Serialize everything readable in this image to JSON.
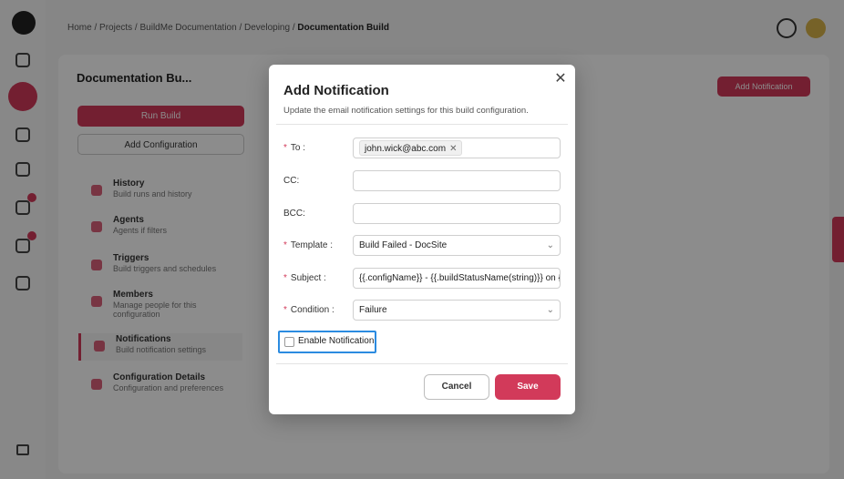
{
  "background": {
    "breadcrumb": {
      "items": [
        "Home",
        "Projects",
        "BuildMe Documentation",
        "Developing"
      ],
      "current": "Documentation Build"
    },
    "panel_title": "Documentation Bu...",
    "run_build": "Run Build",
    "add_config": "Add Configuration",
    "menu": [
      {
        "title": "History",
        "sub": "Build runs and history"
      },
      {
        "title": "Agents",
        "sub": "Agents if filters"
      },
      {
        "title": "Triggers",
        "sub": "Build triggers and schedules"
      },
      {
        "title": "Members",
        "sub": "Manage people for this configuration"
      },
      {
        "title": "Notifications",
        "sub": "Build notification settings"
      },
      {
        "title": "Configuration Details",
        "sub": "Configuration and preferences"
      }
    ],
    "add_notification_btn": "Add Notification",
    "accent": "#d23a5a"
  },
  "modal": {
    "title": "Add Notification",
    "subtitle": "Update the email notification settings for this build configuration.",
    "close_icon": "close-icon",
    "to": {
      "label": "To",
      "chips": [
        "john.wick@abc.com"
      ]
    },
    "cc": {
      "label": "CC:",
      "value": ""
    },
    "bcc": {
      "label": "BCC:",
      "value": ""
    },
    "template": {
      "label": "Template",
      "value": "Build Failed - DocSite"
    },
    "subject": {
      "label": "Subject",
      "value": "{{.configName}} - {{.buildStatusName(string)}} on {{."
    },
    "condition": {
      "label": "Condition",
      "value": "Failure"
    },
    "enable_notification": {
      "label": "Enable Notification",
      "checked": false
    },
    "cancel": "Cancel",
    "save": "Save"
  }
}
